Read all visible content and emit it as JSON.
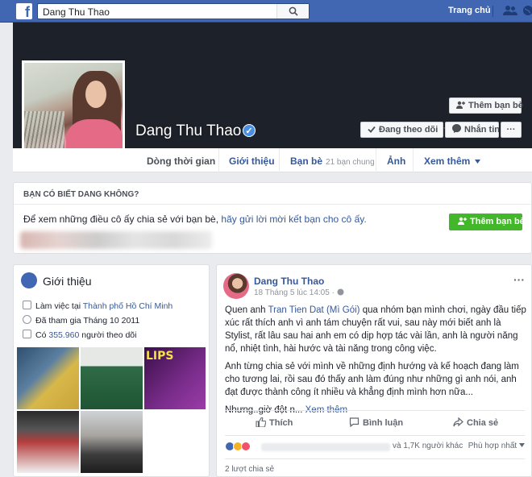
{
  "topbar": {
    "logo": "f",
    "search_value": "Dang Thu Thao",
    "home_label": "Trang chủ"
  },
  "profile": {
    "name": "Dang Thu Thao",
    "verified_mark": "✓",
    "add_friend_label": "Thêm bạn bè",
    "follow_label": "Đang theo dõi",
    "message_label": "Nhắn tin",
    "more_label": "···"
  },
  "nav": {
    "timeline": "Dòng thời gian",
    "about": "Giới thiệu",
    "friends": "Bạn bè",
    "friends_sub": "21 bạn chung",
    "photos": "Ảnh",
    "more": "Xem thêm"
  },
  "pymk": {
    "title": "BẠN CÓ BIẾT DANG KHÔNG?",
    "text": "Để xem những điều cô ấy chia sẻ với bạn bè,",
    "link": "hãy gửi lời mời kết bạn cho cô ấy.",
    "button": "Thêm bạn bè"
  },
  "intro": {
    "title": "Giới thiệu",
    "work_prefix": "Làm việc tại",
    "work_place": "Thành phố Hồ Chí Minh",
    "joined": "Đã tham gia Tháng 10 2011",
    "followers_prefix": "Có",
    "followers_count": "355.960",
    "followers_suffix": "người theo dõi",
    "photo_lips_text": "LIPS"
  },
  "post": {
    "author": "Dang Thu Thao",
    "time": "18 Tháng 5 lúc 14:05",
    "time_sep": "·",
    "menu": "···",
    "p1_a": "Quen anh",
    "p1_link": "Tran Tien Dat (Mì Gói)",
    "p1_b": "qua nhóm bạn mình chơi, ngày đầu tiếp xúc rất thích anh vì anh tám chuyện rất vui, sau này mới biết anh là Stylist, rất lâu sau hai anh em có dịp hợp tác vài lần, anh là người năng nổ, nhiệt tình, hài hước và tài năng trong công việc.",
    "p2": "Anh từng chia sẻ với mình về những định hướng và kế hoạch đang làm cho tương lai, rồi sau đó thấy anh làm đúng như những gì anh nói, anh đạt được thành công ít nhiều và khẳng định mình hơn nữa...",
    "p3_a": "Nhưng..giờ đột n...",
    "p3_link": "Xem thêm",
    "like": "Thích",
    "comment": "Bình luận",
    "share": "Chia sẻ",
    "reaction_count": "và 1,7K người khác",
    "sort": "Phù hợp nhất",
    "shares": "2 lượt chia sẻ"
  },
  "colors": {
    "brand": "#4267b2",
    "link": "#365899",
    "green": "#42b72a",
    "cover": "#1d2129"
  }
}
